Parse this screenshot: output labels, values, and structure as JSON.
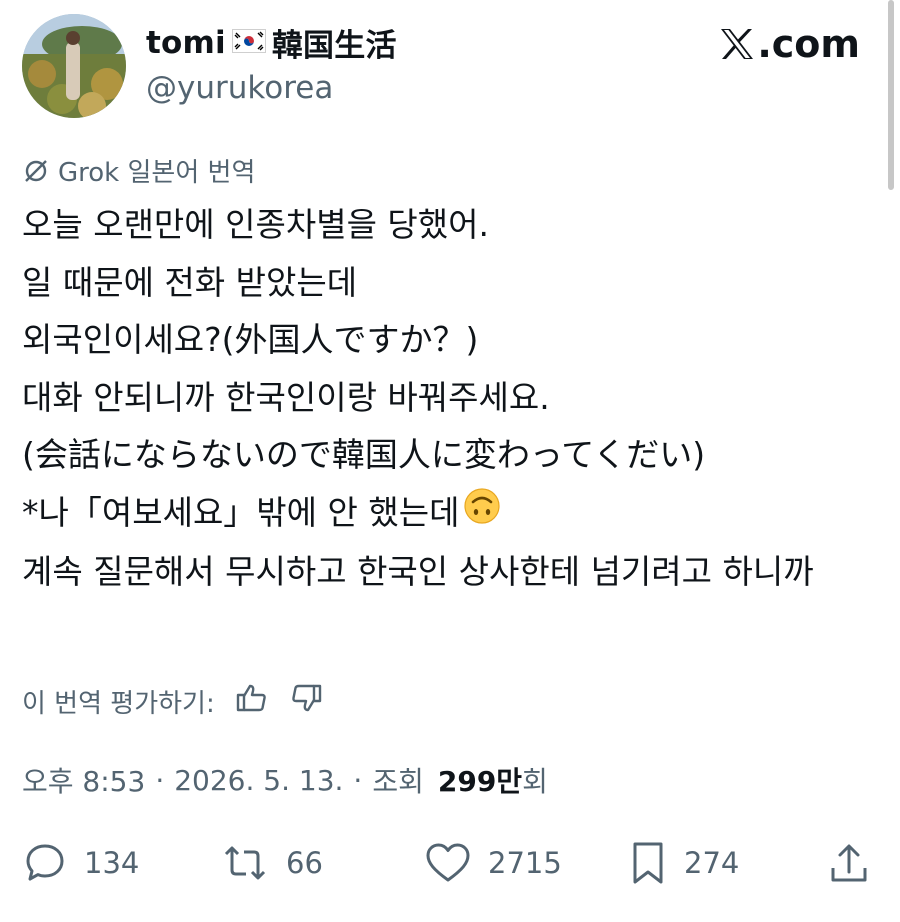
{
  "user": {
    "name": "tomi",
    "name_suffix": "韓国生活",
    "handle": "@yurukorea"
  },
  "brand": {
    "label": ".com"
  },
  "translation": {
    "label": "Grok 일본어 번역"
  },
  "tweet": {
    "lines": [
      "오늘 오랜만에 인종차별을 당했어.",
      "일 때문에 전화 받았는데",
      "외국인이세요?(外国人ですか？)",
      "대화 안되니까 한국인이랑 바꿔주세요.",
      "(会話にならないので韓国人に変わってくだい)",
      "*나「여보세요」밖에 안 했는데",
      "계속 질문해서 무시하고 한국인 상사한테 넘기려고 하니까"
    ]
  },
  "rate": {
    "label": "이 번역 평가하기:"
  },
  "meta": {
    "time": "오후 8:53",
    "sep1": "·",
    "date": "2026. 5. 13.",
    "sep2": "·",
    "views_label": "조회",
    "views_count": "299만",
    "views_unit": "회"
  },
  "actions": {
    "replies": "134",
    "reposts": "66",
    "likes": "2715",
    "bookmarks": "274"
  },
  "icons": {
    "translate": "translate-icon",
    "thumbs_up": "thumbs-up-icon",
    "thumbs_down": "thumbs-down-icon",
    "reply": "reply-icon",
    "repost": "repost-icon",
    "like": "heart-icon",
    "bookmark": "bookmark-icon",
    "share": "share-icon",
    "flag": "korea-flag-icon",
    "emoji": "upside-down-face-icon"
  },
  "colors": {
    "text": "#0f1419",
    "secondary": "#536471"
  }
}
